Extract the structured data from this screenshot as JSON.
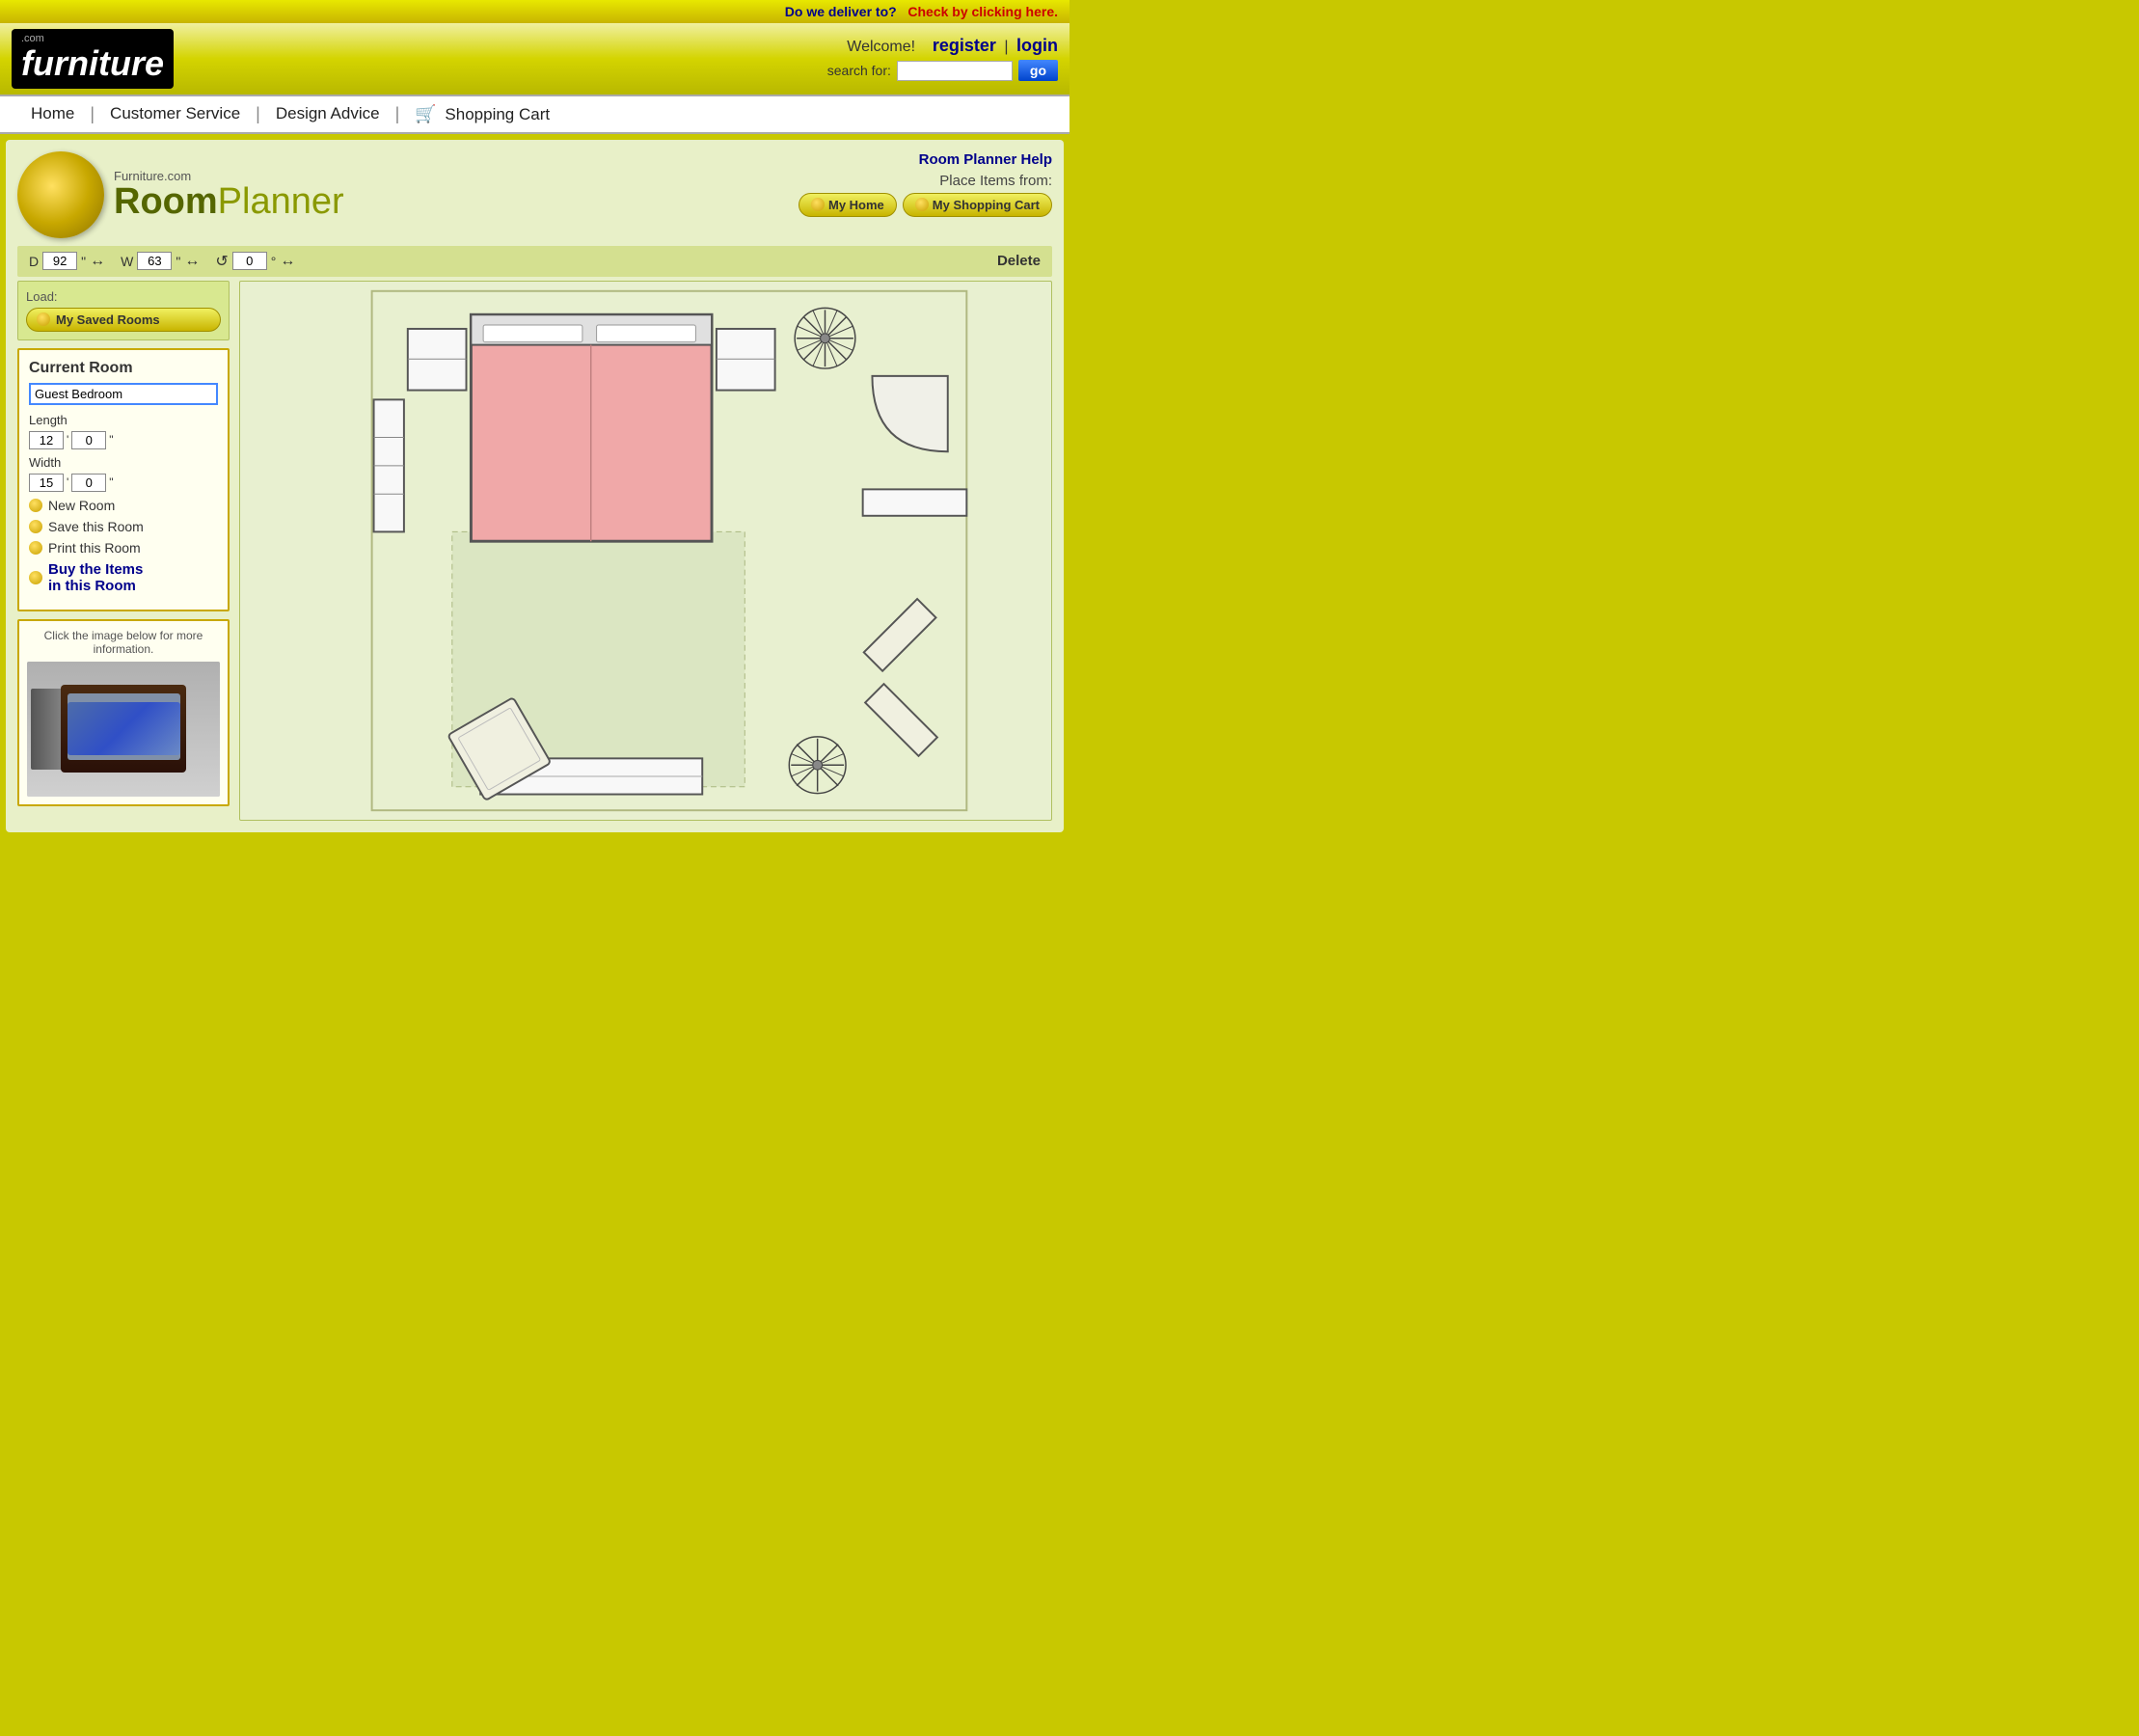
{
  "delivery": {
    "question": "Do we deliver to?",
    "cta": "Check by clicking here."
  },
  "header": {
    "logo_com": ".com",
    "logo_name": "furniture",
    "welcome": "Welcome!",
    "register": "register",
    "separator": "|",
    "login": "login",
    "search_label": "search for:",
    "search_placeholder": "",
    "go_btn": "go"
  },
  "nav": {
    "items": [
      {
        "label": "Home"
      },
      {
        "label": "Customer Service"
      },
      {
        "label": "Design Advice"
      },
      {
        "label": "Shopping Cart"
      }
    ]
  },
  "planner": {
    "logo_fcom": "Furniture.com",
    "logo_room": "Room",
    "logo_planner": "Planner",
    "help_link": "Room Planner Help",
    "place_items_label": "Place Items from:",
    "my_home_btn": "My Home",
    "my_cart_btn": "My Shopping Cart",
    "controls": {
      "d_label": "D",
      "d_value": "92",
      "d_unit": "\"",
      "w_label": "W",
      "w_value": "63",
      "w_unit": "\"",
      "angle_value": "0",
      "angle_unit": "°",
      "delete_btn": "Delete"
    },
    "left": {
      "load_label": "Load:",
      "saved_rooms_btn": "My Saved Rooms",
      "current_room_title": "Current Room",
      "room_name": "Guest Bedroom",
      "length_label": "Length",
      "length_ft": "12",
      "length_in": "0",
      "width_label": "Width",
      "width_ft": "15",
      "width_in": "0",
      "new_room": "New Room",
      "save_room": "Save this Room",
      "print_room": "Print this Room",
      "buy_items": "Buy the Items\nin this Room",
      "thumb_caption": "Click the image below for more information."
    }
  }
}
